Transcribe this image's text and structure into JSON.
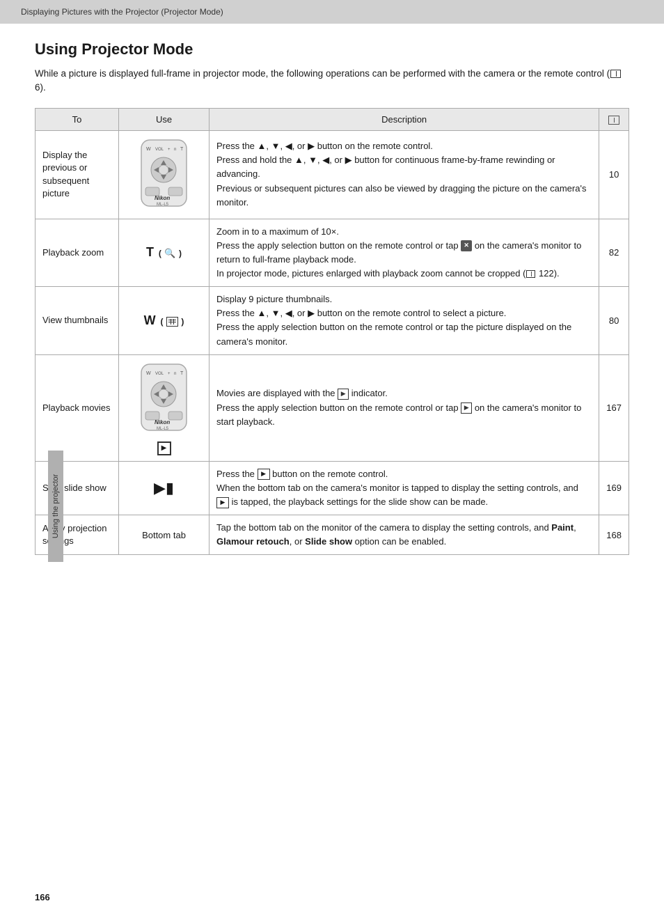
{
  "header": {
    "text": "Displaying Pictures with the Projector (Projector Mode)"
  },
  "page": {
    "title": "Using Projector Mode",
    "intro": "While a picture is displayed full-frame in projector mode, the following operations can be performed with the camera or the remote control (",
    "intro_ref": "6",
    "intro_end": ")."
  },
  "table": {
    "columns": [
      "To",
      "Use",
      "Description",
      ""
    ],
    "rows": [
      {
        "to": "Display the previous or subsequent picture",
        "use": "remote_image",
        "desc_parts": [
          {
            "type": "text",
            "text": "Press the ▲, ▼, ◀, or ▶ button on the remote control."
          },
          {
            "type": "text",
            "text": "Press and hold the ▲, ▼, ◀, or ▶ button for continuous frame-by-frame rewinding or advancing."
          },
          {
            "type": "text",
            "text": "Previous or subsequent pictures can also be viewed by dragging the picture on the camera's monitor."
          }
        ],
        "ref": "10"
      },
      {
        "to": "Playback zoom",
        "use": "T_zoom",
        "desc": "Zoom in to a maximum of 10×.\nPress the apply selection button on the remote control or tap ",
        "desc_icon": "X",
        "desc2": " on the camera's monitor to return to full-frame playback mode.\nIn projector mode, pictures enlarged with playback zoom cannot be cropped (",
        "desc2_ref": "122",
        "desc2_end": ").",
        "ref": "82"
      },
      {
        "to": "View thumbnails",
        "use": "W_thumb",
        "desc": "Display 9 picture thumbnails.\nPress the ▲, ▼, ◀, or ▶ button on the remote control to select a picture.\nPress the apply selection button on the remote control or tap the picture displayed on the camera's monitor.",
        "ref": "80"
      },
      {
        "to": "Playback movies",
        "use": "remote_image2",
        "desc": "Movies are displayed with the ",
        "desc_icon": "movie",
        "desc2": " indicator.\nPress the apply selection button on the remote control or tap ",
        "desc_icon2": "movie",
        "desc3": " on the camera's monitor to start playback.",
        "ref": "167"
      },
      {
        "to": "Start slide show",
        "use": "slideshow_icon",
        "desc": "Press the ",
        "desc_icon": "slideshow",
        "desc2": " button on the remote control.\nWhen the bottom tab on the camera's monitor is tapped to display the setting controls, and ",
        "desc_icon2": "slideshow",
        "desc3": " is tapped, the playback settings for the slide show can be made.",
        "ref": "169"
      },
      {
        "to": "Apply projection settings",
        "use": "Bottom tab",
        "desc": "Tap the bottom tab on the monitor of the camera to display the setting controls, and ",
        "desc_bold1": "Paint",
        "desc_comma": ", ",
        "desc_bold2": "Glamour retouch",
        "desc_comma2": ", or ",
        "desc_bold3": "Slide show",
        "desc_end": " option can be enabled.",
        "ref": "168"
      }
    ]
  },
  "footer": {
    "page_number": "166"
  },
  "side_tab": {
    "label": "Using the projector"
  }
}
